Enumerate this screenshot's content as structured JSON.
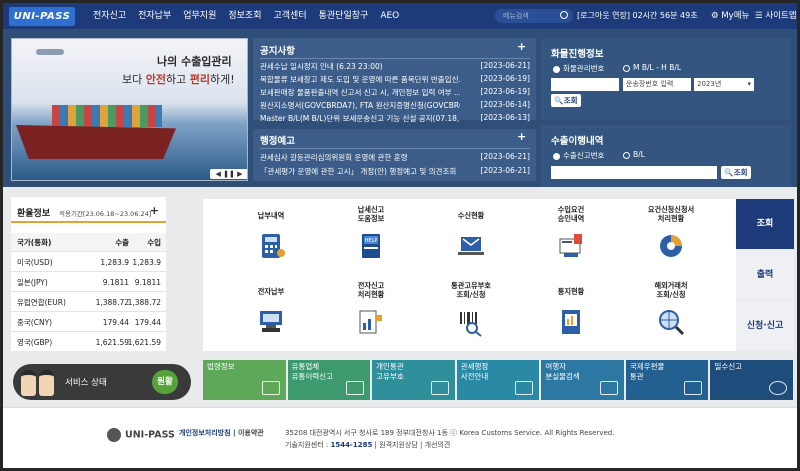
{
  "header": {
    "logo": "UNI-PASS",
    "menu": [
      "전자신고",
      "전자납부",
      "업무지원",
      "정보조회",
      "고객센터",
      "통관단일창구",
      "AEO"
    ],
    "search_placeholder": "메뉴검색",
    "session_timer": "[로그아웃 연장] 02시간 56분 49초",
    "my_menu": "My메뉴",
    "sitemap": "사이트맵"
  },
  "banner": {
    "line1": "나의 수출입관리",
    "line2_prefix": "보다 ",
    "line2_a": "안전",
    "line2_mid": "하고 ",
    "line2_b": "편리",
    "line2_suffix": "하게!",
    "controls": "◀ ❚❚ ▶"
  },
  "notice": {
    "title": "공지사항",
    "items": [
      {
        "text": "관세수납 일시정지 안내 (6.23 23:00)",
        "date": "[2023-06-21]"
      },
      {
        "text": "복합물류 보세창고 제도 도입 및 운영에 따른 품목단위 반출입신...",
        "date": "[2023-06-19]"
      },
      {
        "text": "보세판매장 물품판출내역 신고서 신고 시, 개인정보 입력 여부 ...",
        "date": "[2023-06-19]"
      },
      {
        "text": "원산지소명서(GOVCBRDA7), FTA 원산지증명신청(GOVCBR036) ...",
        "date": "[2023-06-14]"
      },
      {
        "text": "Master B/L(M B/L)단위 보세운송신고 기능 신설 공지(07.18, 20:0...",
        "date": "[2023-06-13]"
      }
    ]
  },
  "admin_notice": {
    "title": "행정예고",
    "items": [
      {
        "text": "관세심사 갈등관리심의위원회 운영에 관한 훈령",
        "date": "[2023-06-21]"
      },
      {
        "text": "「관세평가 운영에 관한 고시」 개정(안) 행정예고 및 의견조회",
        "date": "[2023-06-21]"
      }
    ]
  },
  "cargo": {
    "title": "화물진행정보",
    "radio1": "화물관리번호",
    "radio2": "M B/L - H B/L",
    "carrier_placeholder": "운송장번호 입력",
    "year": "2023년",
    "search": "조회"
  },
  "export": {
    "title": "수출이행내역",
    "radio1": "수출신고번호",
    "radio2": "B/L",
    "search": "조회"
  },
  "rates": {
    "title": "환율정보",
    "period": "적용기간[23.06.18~23.06.24]",
    "headers": [
      "국가(통화)",
      "수출",
      "수입"
    ],
    "rows": [
      {
        "country": "미국(USD)",
        "export": "1,283.9",
        "import": "1,283.9"
      },
      {
        "country": "일본(JPY)",
        "export": "9.1811",
        "import": "9.1811"
      },
      {
        "country": "유럽연합(EUR)",
        "export": "1,388.72",
        "import": "1,388.72"
      },
      {
        "country": "중국(CNY)",
        "export": "179.44",
        "import": "179.44"
      },
      {
        "country": "영국(GBP)",
        "export": "1,621.59",
        "import": "1,621.59"
      }
    ]
  },
  "service": {
    "label": "서비스 상태",
    "status": "원활"
  },
  "services": [
    {
      "label": "납부내역",
      "icon": "calculator-icon"
    },
    {
      "label": "납세신고\n도움정보",
      "icon": "help-book-icon"
    },
    {
      "label": "수신현황",
      "icon": "mail-laptop-icon"
    },
    {
      "label": "수입요건\n승인내역",
      "icon": "approval-doc-icon"
    },
    {
      "label": "요건신청신청서\n처리현황",
      "icon": "chart-pie-icon"
    },
    {
      "label": "전자납부",
      "icon": "terminal-icon"
    },
    {
      "label": "전자신고\n처리현황",
      "icon": "report-chart-icon"
    },
    {
      "label": "통관고유부호\n조회/신청",
      "icon": "barcode-search-icon"
    },
    {
      "label": "통지현황",
      "icon": "notice-chart-icon"
    },
    {
      "label": "해외거래처\n조회/신청",
      "icon": "globe-search-icon"
    }
  ],
  "tabs": [
    "조회",
    "출력",
    "신청·신고"
  ],
  "quick": [
    {
      "label": "법령정보",
      "color": "#5ea85a",
      "icon": "book-icon"
    },
    {
      "label": "유통업체\n유통이력신고",
      "color": "#3e9a6e",
      "icon": "pen-icon"
    },
    {
      "label": "개인통관\n고유부호",
      "color": "#2f8f9a",
      "icon": "barcode-icon"
    },
    {
      "label": "관세행정\n사전안내",
      "color": "#2a8aa6",
      "icon": "person-icon"
    },
    {
      "label": "여행자\n분실물검색",
      "color": "#2d78a3",
      "icon": "suitcase-icon"
    },
    {
      "label": "국제우편물\n통관",
      "color": "#235f8f",
      "icon": "cart-icon"
    },
    {
      "label": "밀수신고",
      "color": "#1e4d7c",
      "icon": "phone-24-icon"
    }
  ],
  "footer": {
    "logo": "UNI-PASS",
    "privacy": "개인정보처리방침",
    "terms": "이용약관",
    "address": "35208 대전광역시 서구 청사로 189 정부대전청사 1동 ⓒ Korea Customs Service. All Rights Reserved.",
    "tech_label": "기술지원센터 : ",
    "tech_phone": "1544-1285",
    "help": "원격지원상담",
    "opinion": "개선의견"
  },
  "colors": {
    "header": "#1d3b7a",
    "panel": "#3c5d8a",
    "accent_orange": "#e6a030",
    "tab_active": "#1d3b7a"
  }
}
